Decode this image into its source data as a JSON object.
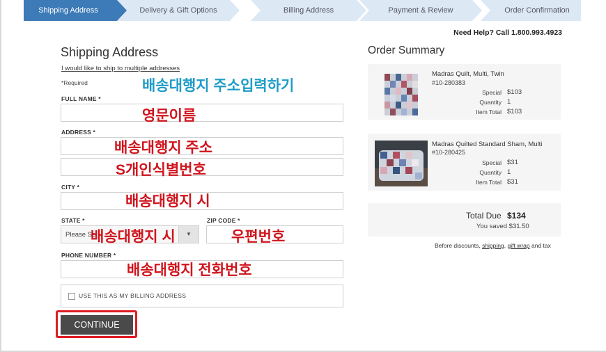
{
  "steps": [
    {
      "label": "Shipping Address",
      "active": true
    },
    {
      "label": "Delivery & Gift Options",
      "active": false
    },
    {
      "label": "Billing Address",
      "active": false
    },
    {
      "label": "Payment & Review",
      "active": false
    },
    {
      "label": "Order Confirmation",
      "active": false
    }
  ],
  "help": "Need Help? Call 1.800.993.4923",
  "form": {
    "title": "Shipping Address",
    "multi_link": "I would like to ship to multiple addresses",
    "required": "*Required",
    "full_name_label": "FULL NAME *",
    "address_label": "ADDRESS *",
    "city_label": "CITY *",
    "state_label": "STATE *",
    "state_value": "Please Se",
    "zip_label": "ZIP CODE *",
    "phone_label": "PHONE NUMBER *",
    "billing_checkbox": "USE THIS AS MY BILLING ADDRESS",
    "continue": "CONTINUE"
  },
  "annotations": {
    "intro": "배송대행지 주소입력하기",
    "full_name": "영문이름",
    "address": "배송대행지 주소",
    "address2": "S개인식별번호",
    "city": "배송대행지 시",
    "state": "배송대행지 시",
    "zip": "우편번호",
    "phone": "배송대행지 전화번호"
  },
  "summary": {
    "title": "Order Summary",
    "items": [
      {
        "name": "Madras Quilt, Multi, Twin",
        "sku": "#10-280383",
        "special_label": "Special",
        "special": "$103",
        "qty_label": "Quantity",
        "qty": "1",
        "total_label": "Item Total",
        "total": "$103"
      },
      {
        "name": "Madras Quilted Standard Sham, Multi",
        "sku": "#10-280425",
        "special_label": "Special",
        "special": "$31",
        "qty_label": "Quantity",
        "qty": "1",
        "total_label": "Item Total",
        "total": "$31"
      }
    ],
    "total_label": "Total Due",
    "total_value": "$134",
    "saved": "You saved $31.50",
    "before_prefix": "Before discounts,",
    "before_shipping": "shipping",
    "before_sep": ",",
    "before_gift": "gift wrap",
    "before_suffix": "and tax"
  },
  "colors": {
    "active_step": "#3d7ab8",
    "inactive_step": "#dce8f4",
    "annotation_red": "#d0141d",
    "annotation_blue": "#1f9bc8",
    "highlight": "#e01b24"
  }
}
